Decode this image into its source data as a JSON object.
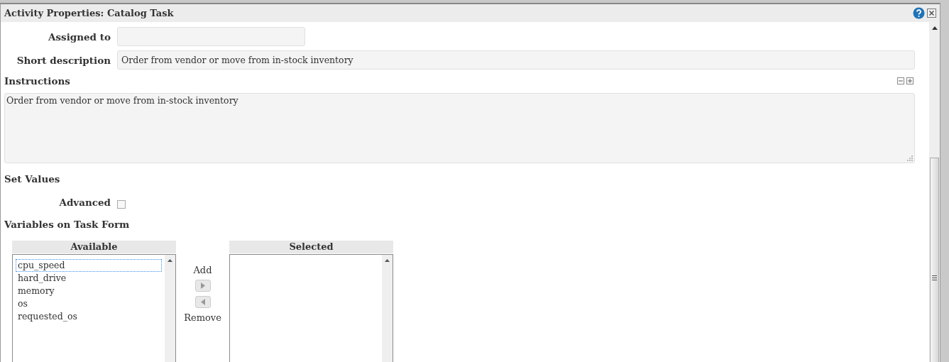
{
  "window": {
    "title": "Activity Properties: Catalog Task"
  },
  "fields": {
    "assigned_to": {
      "label": "Assigned to"
    },
    "short_description": {
      "label": "Short description",
      "value": "Order from vendor or move from in-stock inventory"
    }
  },
  "instructions": {
    "label": "Instructions",
    "value": "Order from vendor or move from in-stock inventory"
  },
  "set_values": {
    "title": "Set Values",
    "advanced": {
      "label": "Advanced",
      "checked": false
    }
  },
  "variables": {
    "title": "Variables on Task Form",
    "available": {
      "title": "Available",
      "items": [
        {
          "label": "cpu_speed",
          "focused": true
        },
        {
          "label": "hard_drive",
          "focused": false
        },
        {
          "label": "memory",
          "focused": false
        },
        {
          "label": "os",
          "focused": false
        },
        {
          "label": "requested_os",
          "focused": false
        }
      ]
    },
    "add_label": "Add",
    "remove_label": "Remove",
    "selected": {
      "title": "Selected"
    }
  }
}
